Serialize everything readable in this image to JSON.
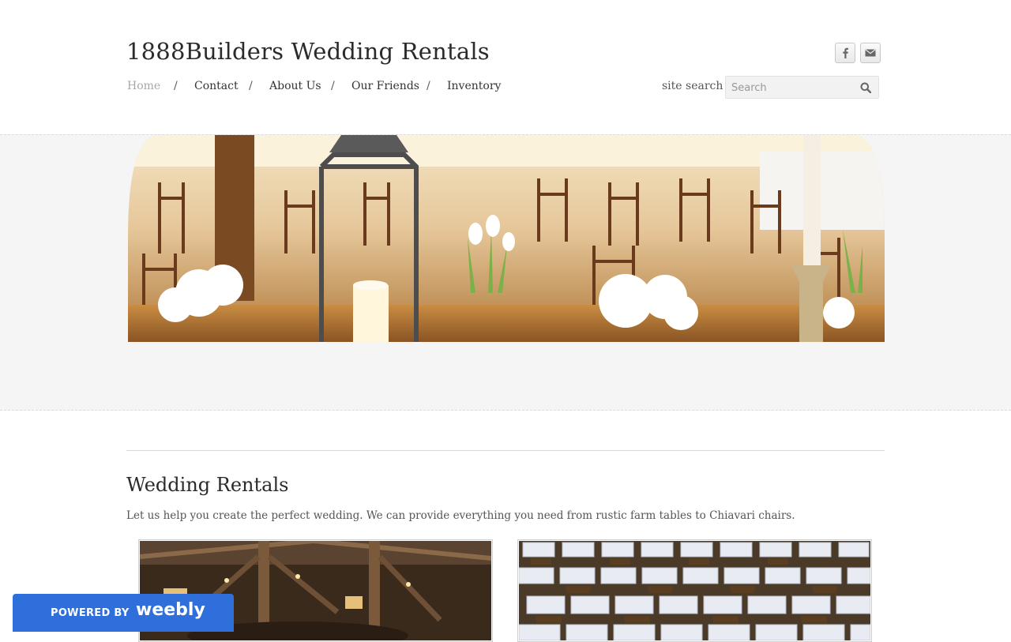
{
  "site": {
    "title": "1888Builders Wedding Rentals"
  },
  "nav": {
    "items": [
      {
        "label": "Home",
        "active": true
      },
      {
        "label": "Contact"
      },
      {
        "label": "About Us"
      },
      {
        "label": "Our Friends"
      },
      {
        "label": "Inventory"
      }
    ],
    "separator": "/"
  },
  "social": [
    {
      "icon": "facebook-icon",
      "glyph": "f"
    },
    {
      "icon": "mail-icon",
      "glyph": "✉"
    }
  ],
  "search": {
    "label": "site search",
    "placeholder": "Search"
  },
  "main": {
    "heading": "Wedding Rentals",
    "intro": "Let us help you create the perfect wedding.  We can provide everything you need from rustic farm tables to Chiavari chairs."
  },
  "footer_badge": {
    "prefix": "POWERED BY",
    "brand": "weebly",
    "color": "#2f6fdc"
  }
}
